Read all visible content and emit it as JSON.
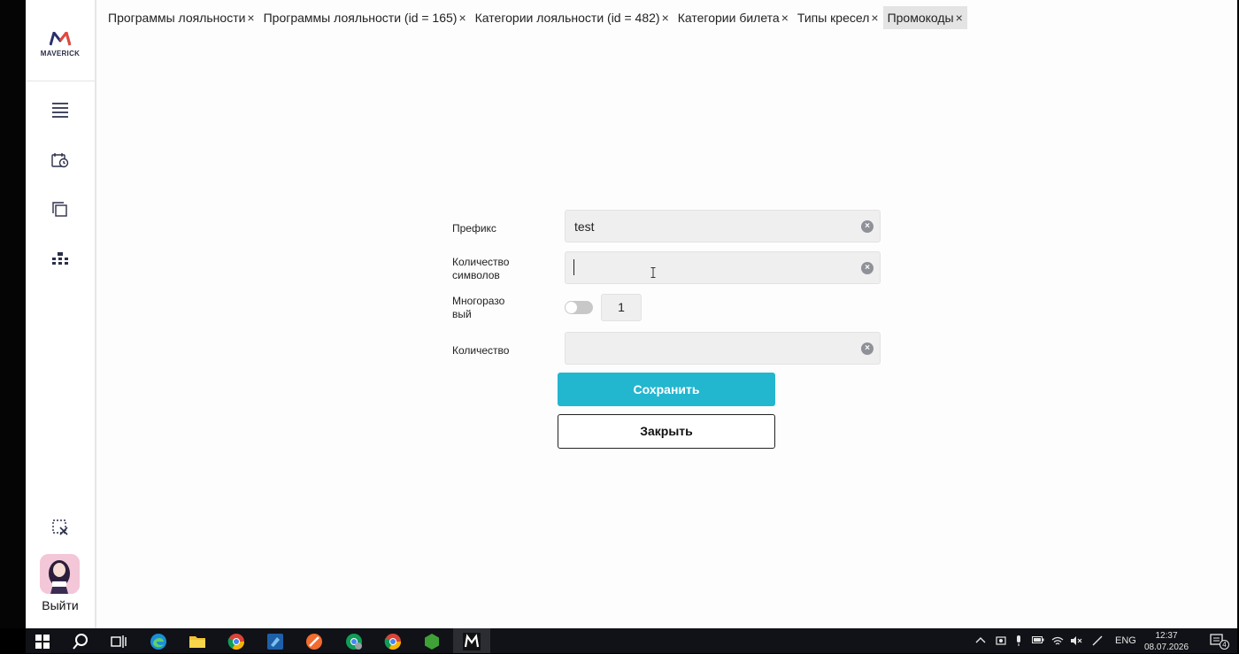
{
  "app": {
    "brand": "MAVERICK",
    "logout_label": "Выйти"
  },
  "tabs": [
    {
      "label": "Программы лояльности",
      "close": "×",
      "active": false
    },
    {
      "label": "Программы лояльности (id = 165)",
      "close": "×",
      "active": false
    },
    {
      "label": "Категории лояльности (id = 482)",
      "close": "×",
      "active": false
    },
    {
      "label": "Категории билета",
      "close": "×",
      "active": false
    },
    {
      "label": "Типы кресел",
      "close": "×",
      "active": false
    },
    {
      "label": "Промокоды",
      "close": "×",
      "active": true
    }
  ],
  "form": {
    "prefix_label": "Префикс",
    "prefix_value": "test",
    "chars_label_line1": "Количество",
    "chars_label_line2": "символов",
    "chars_value": "",
    "reusable_label_line1": "Многоразо",
    "reusable_label_line2": "вый",
    "reusable_on": false,
    "reusable_count": "1",
    "count_label": "Количество",
    "count_value": "",
    "save_label": "Сохранить",
    "close_label": "Закрыть"
  },
  "taskbar": {
    "lang": "ENG",
    "time": "12:37",
    "date": "08.07.2026",
    "notifications": "4"
  },
  "colors": {
    "accent": "#23b6cf",
    "toggle_off": "#c8c8c8"
  }
}
